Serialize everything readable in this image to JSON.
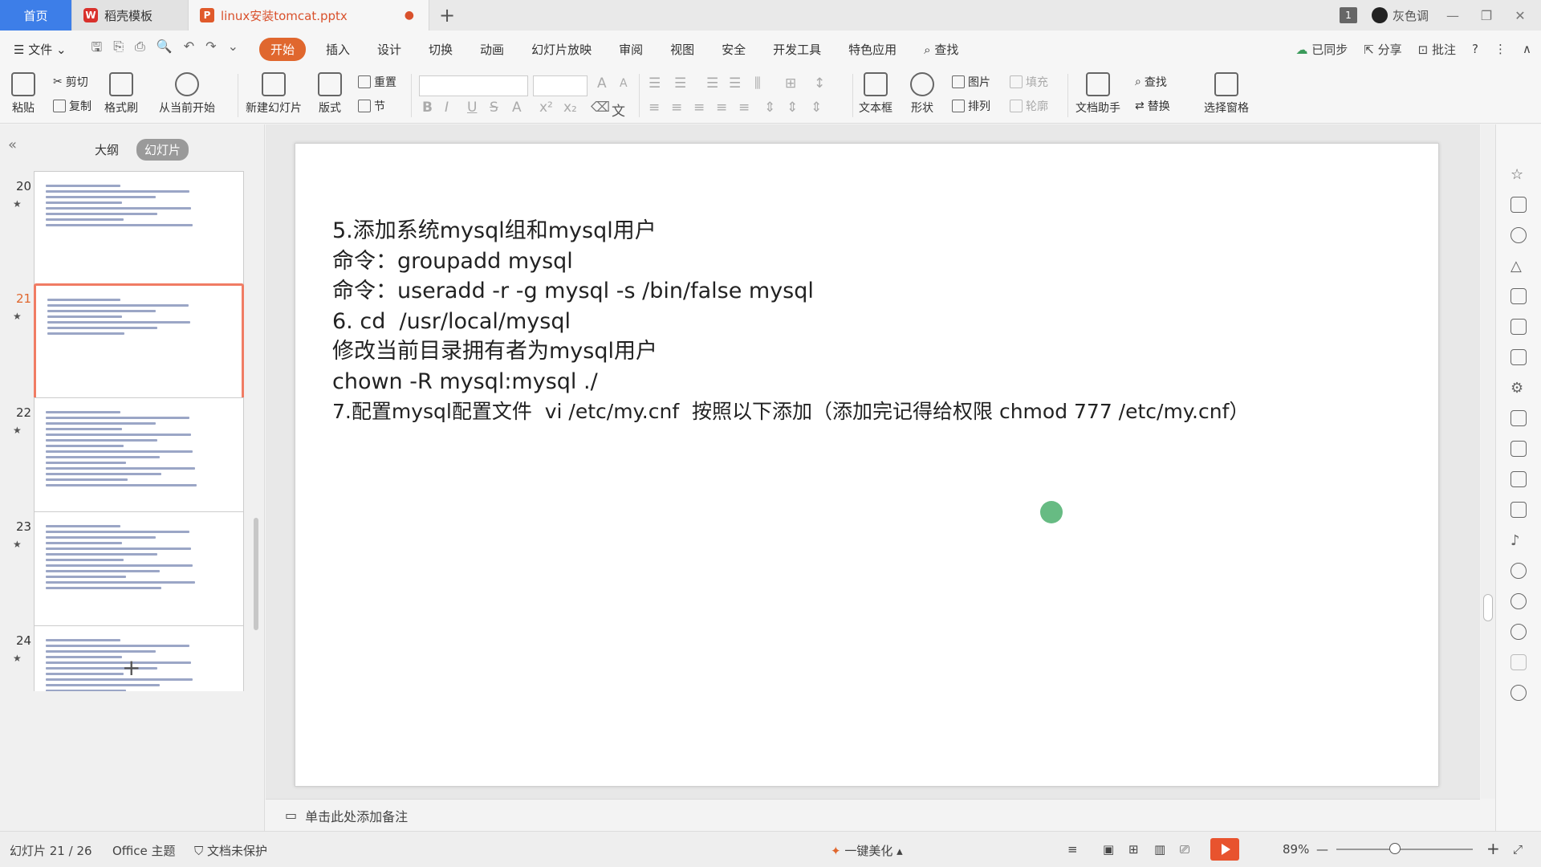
{
  "tabs": {
    "home": "首页",
    "template": "稻壳模板",
    "document": "linux安装tomcat.pptx",
    "document_modified_marker": "●",
    "add": "+"
  },
  "titlebar": {
    "badge": "1",
    "user": "灰色调",
    "minimize": "—",
    "restore": "❐",
    "close": "✕"
  },
  "menu": {
    "file": "文件",
    "items": [
      "开始",
      "插入",
      "设计",
      "切换",
      "动画",
      "幻灯片放映",
      "审阅",
      "视图",
      "安全",
      "开发工具",
      "特色应用"
    ],
    "active_index": 0,
    "search": "查找",
    "sync": "已同步",
    "share": "分享",
    "comment": "批注"
  },
  "ribbon": {
    "paste": "粘贴",
    "cut": "剪切",
    "copy": "复制",
    "format_painter": "格式刷",
    "play_from_current": "从当前开始",
    "new_slide": "新建幻灯片",
    "layout": "版式",
    "reset": "重置",
    "section": "节",
    "textbox": "文本框",
    "shape": "形状",
    "picture": "图片",
    "arrange": "排列",
    "fill": "填充",
    "outline": "轮廓",
    "doc_assistant": "文档助手",
    "find": "查找",
    "replace": "替换",
    "select_pane": "选择窗格",
    "font_bold": "B",
    "font_italic": "I",
    "font_underline": "U",
    "font_strike": "S",
    "font_color": "A",
    "grow_font": "A",
    "shrink_font": "A"
  },
  "left_panel": {
    "tab_outline": "大纲",
    "tab_slides": "幻灯片",
    "thumbnails": [
      {
        "num": "20",
        "lines": 8
      },
      {
        "num": "21",
        "lines": 7
      },
      {
        "num": "22",
        "lines": 14
      },
      {
        "num": "23",
        "lines": 12
      },
      {
        "num": "24",
        "lines": 10
      }
    ],
    "current": "21",
    "star": "★",
    "add": "+"
  },
  "slide": {
    "lines": [
      "5.添加系统mysql组和mysql用户",
      "命令：groupadd mysql",
      "",
      "命令：useradd -r -g mysql -s /bin/false mysql",
      "",
      "6. cd  /usr/local/mysql",
      "修改当前目录拥有者为mysql用户",
      "chown -R mysql:mysql ./",
      "7.配置mysql配置文件  vi /etc/my.cnf  按照以下添加（添加完记得给权限 chmod 777 /etc/my.cnf）"
    ]
  },
  "notes": {
    "placeholder": "单击此处添加备注"
  },
  "statusbar": {
    "slide_info": "幻灯片 21 / 26",
    "theme": "Office 主题",
    "protect": "文档未保护",
    "beautify": "一键美化",
    "zoom": "89%",
    "zoom_minus": "—",
    "zoom_plus": "+"
  },
  "colors": {
    "accent": "#e0672e",
    "home_tab": "#3d7ee8",
    "play": "#e8532e",
    "current_thumb_border": "#f07c64"
  }
}
